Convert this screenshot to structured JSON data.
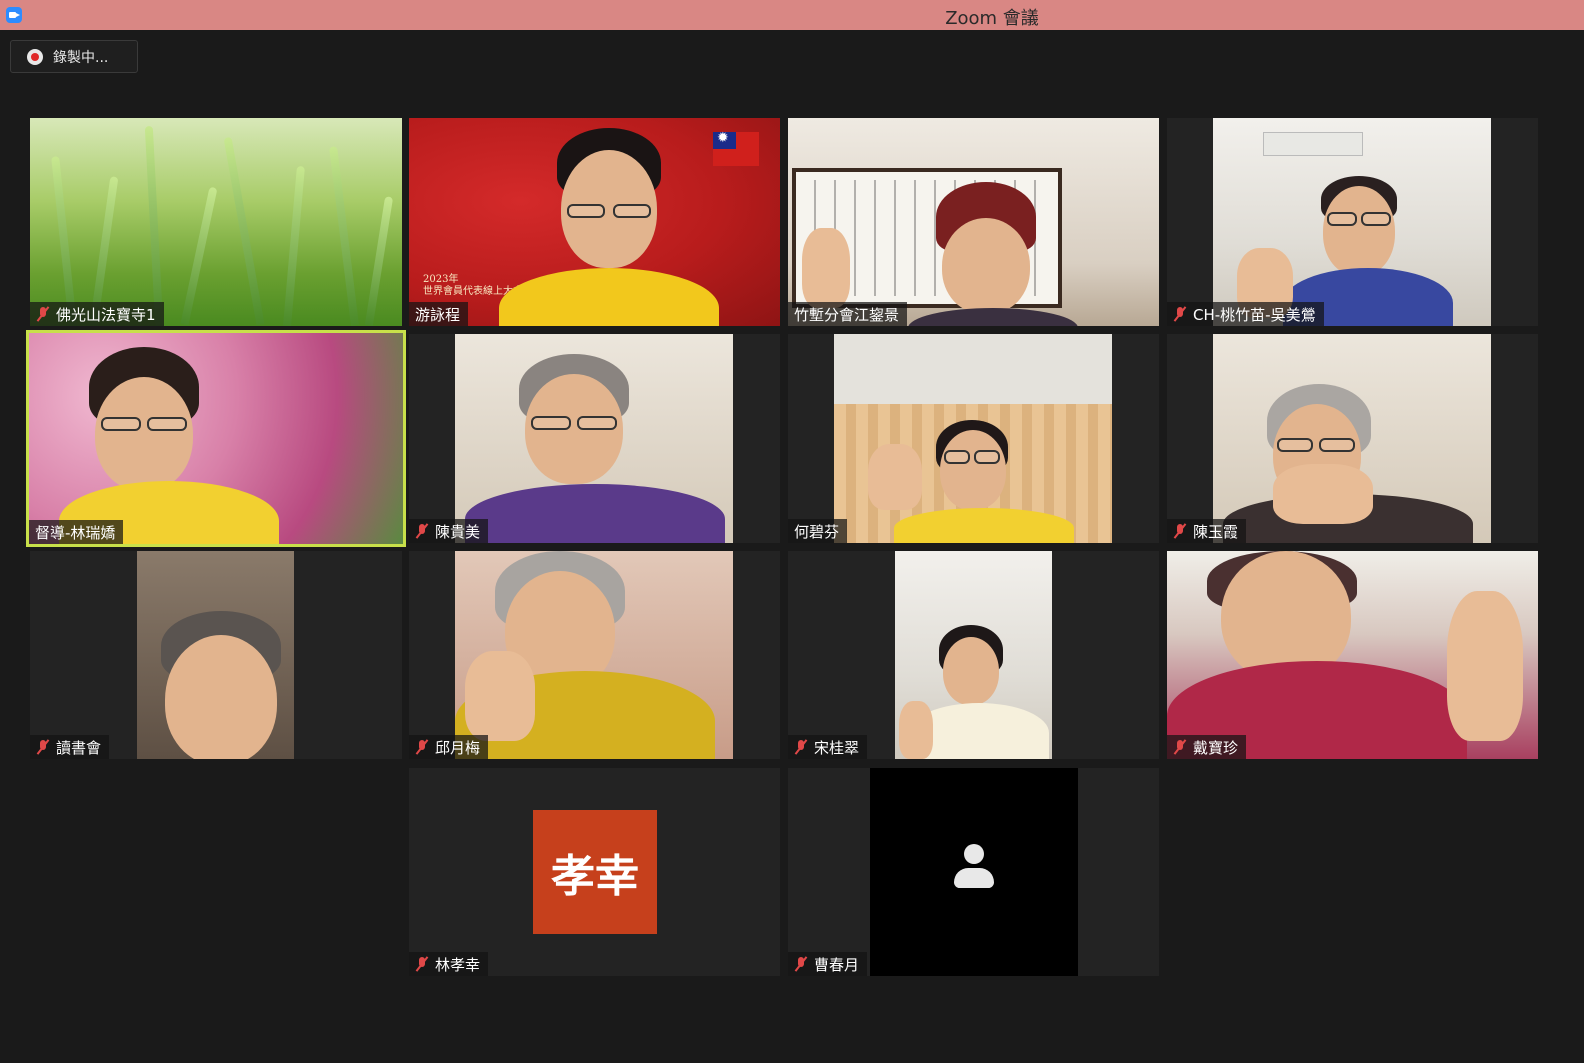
{
  "window": {
    "title": "Zoom 會議"
  },
  "recording": {
    "label": "錄製中..."
  },
  "participants": [
    {
      "name": "佛光山法寶寺1",
      "muted": true
    },
    {
      "name": "游詠程",
      "muted": false
    },
    {
      "name": "竹塹分會江鋆景",
      "muted": false
    },
    {
      "name": "CH-桃竹苗-吳美鶯",
      "muted": true
    },
    {
      "name": "督導-林瑞嬌",
      "muted": false,
      "speaking": true
    },
    {
      "name": "陳貴美",
      "muted": true
    },
    {
      "name": "何碧芬",
      "muted": false
    },
    {
      "name": "陳玉霞",
      "muted": true
    },
    {
      "name": "讀書會",
      "muted": true
    },
    {
      "name": "邱月梅",
      "muted": true
    },
    {
      "name": "宋桂翠",
      "muted": true
    },
    {
      "name": "戴寶珍",
      "muted": true
    },
    {
      "name": "林孝幸",
      "muted": true,
      "avatar_text": "孝幸"
    },
    {
      "name": "曹春月",
      "muted": true,
      "video_off": true
    }
  ],
  "poster": {
    "line1": "2023年",
    "line2": "世界會員代表線上大會"
  },
  "colors": {
    "titlebar": "#d98784",
    "background": "#1a1a1a",
    "speaking_outline": "#c8e04a",
    "mute_red": "#e04848",
    "avatar_bg": "#c6401c"
  }
}
